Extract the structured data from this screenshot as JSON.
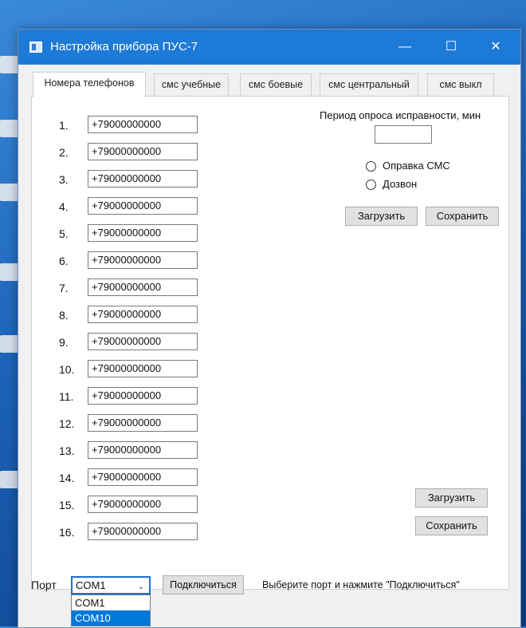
{
  "window": {
    "title": "Настройка прибора ПУС-7"
  },
  "title_buttons": {
    "minimize": "—",
    "maximize": "☐",
    "close": "✕"
  },
  "tabs": [
    {
      "label": "Номера телефонов"
    },
    {
      "label": "смс учебные"
    },
    {
      "label": "смс боевые"
    },
    {
      "label": "смс центральный"
    },
    {
      "label": "смс выкл"
    }
  ],
  "phones": [
    {
      "num": "1.",
      "value": "+79000000000"
    },
    {
      "num": "2.",
      "value": "+79000000000"
    },
    {
      "num": "3.",
      "value": "+79000000000"
    },
    {
      "num": "4.",
      "value": "+79000000000"
    },
    {
      "num": "5.",
      "value": "+79000000000"
    },
    {
      "num": "6.",
      "value": "+79000000000"
    },
    {
      "num": "7.",
      "value": "+79000000000"
    },
    {
      "num": "8.",
      "value": "+79000000000"
    },
    {
      "num": "9.",
      "value": "+79000000000"
    },
    {
      "num": "10.",
      "value": "+79000000000"
    },
    {
      "num": "11.",
      "value": "+79000000000"
    },
    {
      "num": "12.",
      "value": "+79000000000"
    },
    {
      "num": "13.",
      "value": "+79000000000"
    },
    {
      "num": "14.",
      "value": "+79000000000"
    },
    {
      "num": "15.",
      "value": "+79000000000"
    },
    {
      "num": "16.",
      "value": "+79000000000"
    }
  ],
  "settings": {
    "poll_label": "Период опроса исправности, мин",
    "poll_value": "",
    "radio_sms": "Оправка СМС",
    "radio_call": "Дозвон",
    "load_label": "Загрузить",
    "save_label": "Сохранить"
  },
  "bottom_buttons": {
    "load_label": "Загрузить",
    "save_label": "Сохранить"
  },
  "port": {
    "label": "Порт",
    "selected": "COM1",
    "options": [
      "COM1",
      "COM10"
    ],
    "highlighted": "COM10",
    "connect_label": "Подключиться",
    "status": "Выберите порт и нажмите \"Подключиться\""
  }
}
